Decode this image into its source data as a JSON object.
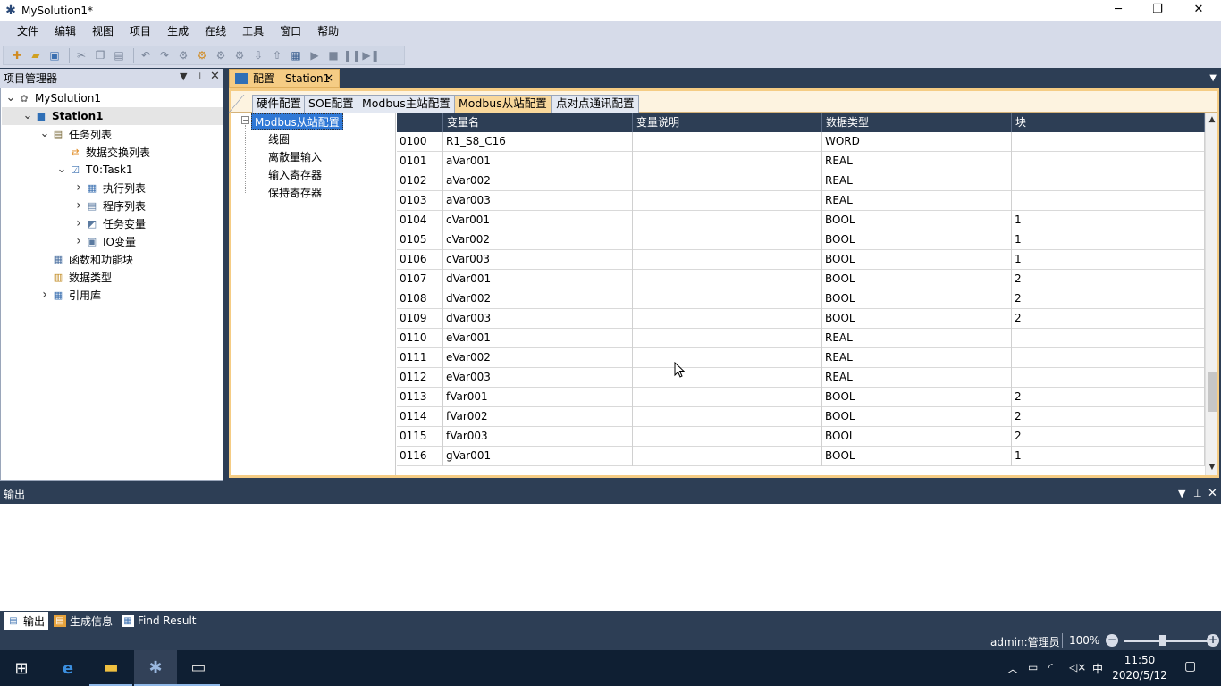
{
  "window": {
    "title": "MySolution1*",
    "controls": {
      "minimize": "─",
      "restore": "❐",
      "close": "✕"
    }
  },
  "menu": [
    "文件",
    "编辑",
    "视图",
    "项目",
    "生成",
    "在线",
    "工具",
    "窗口",
    "帮助"
  ],
  "toolbar": {
    "buttons": [
      "new-icon",
      "open-icon",
      "save-all-icon",
      "cut-icon",
      "copy-icon",
      "paste-icon",
      "undo-icon",
      "redo-icon",
      "build-icon",
      "build-solution-icon",
      "download-icon",
      "upload-icon",
      "import-icon",
      "export-icon",
      "monitor-icon",
      "run-icon",
      "stop-icon",
      "pause-icon",
      "step-icon"
    ]
  },
  "project_manager": {
    "title": "项目管理器",
    "tree": [
      {
        "label": "MySolution1",
        "level": 0,
        "expanded": true,
        "icon": "solution-icon",
        "bold": false
      },
      {
        "label": "Station1",
        "level": 1,
        "expanded": true,
        "icon": "station-icon",
        "bold": true,
        "selected": true
      },
      {
        "label": "任务列表",
        "level": 2,
        "expanded": true,
        "icon": "task-list-icon",
        "bold": false
      },
      {
        "label": "数据交换列表",
        "level": 3,
        "expanded": null,
        "icon": "exchange-icon",
        "bold": false
      },
      {
        "label": "T0:Task1",
        "level": 3,
        "expanded": true,
        "icon": "task-icon",
        "bold": false
      },
      {
        "label": "执行列表",
        "level": 4,
        "expanded": false,
        "icon": "table-icon",
        "bold": false
      },
      {
        "label": "程序列表",
        "level": 4,
        "expanded": false,
        "icon": "program-icon",
        "bold": false
      },
      {
        "label": "任务变量",
        "level": 4,
        "expanded": false,
        "icon": "variable-icon",
        "bold": false
      },
      {
        "label": "IO变量",
        "level": 4,
        "expanded": false,
        "icon": "io-icon",
        "bold": false
      },
      {
        "label": "函数和功能块",
        "level": 2,
        "expanded": null,
        "icon": "function-block-icon",
        "bold": false
      },
      {
        "label": "数据类型",
        "level": 2,
        "expanded": null,
        "icon": "datatype-icon",
        "bold": false
      },
      {
        "label": "引用库",
        "level": 2,
        "expanded": false,
        "icon": "library-icon",
        "bold": false
      }
    ]
  },
  "document": {
    "tab_label": "配置 - Station1",
    "close": "×",
    "subtabs": [
      "硬件配置",
      "SOE配置",
      "Modbus主站配置",
      "Modbus从站配置",
      "点对点通讯配置"
    ],
    "active_subtab": 3,
    "config_tree": {
      "root": "Modbus从站配置",
      "children": [
        "线圈",
        "离散量输入",
        "输入寄存器",
        "保持寄存器"
      ]
    },
    "grid": {
      "columns": [
        "",
        "变量名",
        "变量说明",
        "数据类型",
        "块"
      ],
      "rows": [
        [
          "0100",
          "R1_S8_C16",
          "",
          "WORD",
          ""
        ],
        [
          "0101",
          "aVar001",
          "",
          "REAL",
          ""
        ],
        [
          "0102",
          "aVar002",
          "",
          "REAL",
          ""
        ],
        [
          "0103",
          "aVar003",
          "",
          "REAL",
          ""
        ],
        [
          "0104",
          "cVar001",
          "",
          "BOOL",
          "1"
        ],
        [
          "0105",
          "cVar002",
          "",
          "BOOL",
          "1"
        ],
        [
          "0106",
          "cVar003",
          "",
          "BOOL",
          "1"
        ],
        [
          "0107",
          "dVar001",
          "",
          "BOOL",
          "2"
        ],
        [
          "0108",
          "dVar002",
          "",
          "BOOL",
          "2"
        ],
        [
          "0109",
          "dVar003",
          "",
          "BOOL",
          "2"
        ],
        [
          "0110",
          "eVar001",
          "",
          "REAL",
          ""
        ],
        [
          "0111",
          "eVar002",
          "",
          "REAL",
          ""
        ],
        [
          "0112",
          "eVar003",
          "",
          "REAL",
          ""
        ],
        [
          "0113",
          "fVar001",
          "",
          "BOOL",
          "2"
        ],
        [
          "0114",
          "fVar002",
          "",
          "BOOL",
          "2"
        ],
        [
          "0115",
          "fVar003",
          "",
          "BOOL",
          "2"
        ],
        [
          "0116",
          "gVar001",
          "",
          "BOOL",
          "1"
        ]
      ]
    }
  },
  "output": {
    "title": "输出",
    "tabs": [
      "输出",
      "生成信息",
      "Find Result"
    ]
  },
  "status": {
    "user": "admin:管理员",
    "zoom": "100%",
    "zoom_fraction": 0.5
  },
  "taskbar": {
    "items": [
      "windows-start-icon",
      "edge-icon",
      "file-explorer-icon",
      "app-icon",
      "remote-icon"
    ],
    "ime": "中",
    "time": "11:50",
    "date": "2020/5/12"
  },
  "colors": {
    "chrome_dark": "#2d3e55",
    "chrome_light": "#d6dbe9",
    "active_tab": "#f5cc84",
    "selection": "#2f78d6"
  }
}
